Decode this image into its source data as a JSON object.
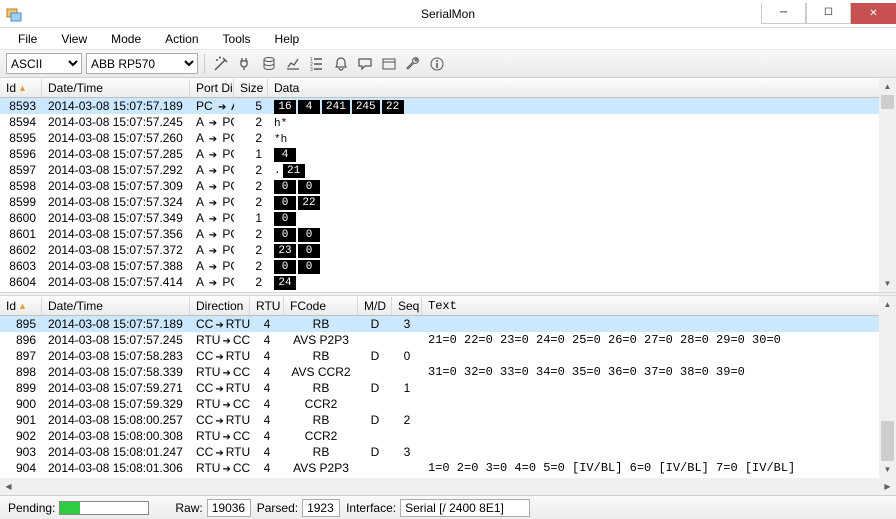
{
  "window": {
    "title": "SerialMon"
  },
  "menu": {
    "items": [
      "File",
      "View",
      "Mode",
      "Action",
      "Tools",
      "Help"
    ]
  },
  "toolbar": {
    "encoding_options": [
      "ASCII"
    ],
    "encoding_value": "ASCII",
    "protocol_options": [
      "ABB RP570"
    ],
    "protocol_value": "ABB RP570",
    "icons": [
      "wand",
      "plug",
      "database",
      "chart",
      "list",
      "bell",
      "comment",
      "window",
      "wrench",
      "info"
    ]
  },
  "grid1": {
    "headers": {
      "id": "Id",
      "datetime": "Date/Time",
      "portdir": "Port Dir",
      "size": "Size",
      "data": "Data"
    },
    "rows": [
      {
        "id": 8593,
        "dt": "2014-03-08 15:07:57.189",
        "pdA": "PC",
        "pdB": "A",
        "size": 5,
        "data": [
          {
            "t": "b",
            "v": "16"
          },
          {
            "t": "b",
            "v": "4"
          },
          {
            "t": "b",
            "v": "241"
          },
          {
            "t": "b",
            "v": "245"
          },
          {
            "t": "b",
            "v": "22"
          }
        ],
        "sel": true
      },
      {
        "id": 8594,
        "dt": "2014-03-08 15:07:57.245",
        "pdA": "A",
        "pdB": "PC",
        "size": 2,
        "data": [
          {
            "t": "p",
            "v": "h*"
          }
        ]
      },
      {
        "id": 8595,
        "dt": "2014-03-08 15:07:57.260",
        "pdA": "A",
        "pdB": "PC",
        "size": 2,
        "data": [
          {
            "t": "p",
            "v": "*h"
          }
        ]
      },
      {
        "id": 8596,
        "dt": "2014-03-08 15:07:57.285",
        "pdA": "A",
        "pdB": "PC",
        "size": 1,
        "data": [
          {
            "t": "b",
            "v": "4"
          }
        ]
      },
      {
        "id": 8597,
        "dt": "2014-03-08 15:07:57.292",
        "pdA": "A",
        "pdB": "PC",
        "size": 2,
        "data": [
          {
            "t": "p",
            "v": "."
          },
          {
            "t": "b",
            "v": "21"
          }
        ]
      },
      {
        "id": 8598,
        "dt": "2014-03-08 15:07:57.309",
        "pdA": "A",
        "pdB": "PC",
        "size": 2,
        "data": [
          {
            "t": "b",
            "v": "0"
          },
          {
            "t": "b",
            "v": "0"
          }
        ]
      },
      {
        "id": 8599,
        "dt": "2014-03-08 15:07:57.324",
        "pdA": "A",
        "pdB": "PC",
        "size": 2,
        "data": [
          {
            "t": "b",
            "v": "0"
          },
          {
            "t": "b",
            "v": "22"
          }
        ]
      },
      {
        "id": 8600,
        "dt": "2014-03-08 15:07:57.349",
        "pdA": "A",
        "pdB": "PC",
        "size": 1,
        "data": [
          {
            "t": "b",
            "v": "0"
          }
        ]
      },
      {
        "id": 8601,
        "dt": "2014-03-08 15:07:57.356",
        "pdA": "A",
        "pdB": "PC",
        "size": 2,
        "data": [
          {
            "t": "b",
            "v": "0"
          },
          {
            "t": "b",
            "v": "0"
          }
        ]
      },
      {
        "id": 8602,
        "dt": "2014-03-08 15:07:57.372",
        "pdA": "A",
        "pdB": "PC",
        "size": 2,
        "data": [
          {
            "t": "b",
            "v": "23"
          },
          {
            "t": "b",
            "v": "0"
          }
        ]
      },
      {
        "id": 8603,
        "dt": "2014-03-08 15:07:57.388",
        "pdA": "A",
        "pdB": "PC",
        "size": 2,
        "data": [
          {
            "t": "b",
            "v": "0"
          },
          {
            "t": "b",
            "v": "0"
          }
        ]
      },
      {
        "id": 8604,
        "dt": "2014-03-08 15:07:57.414",
        "pdA": "A",
        "pdB": "PC",
        "size": 2,
        "data": [
          {
            "t": "b",
            "v": "24"
          }
        ]
      }
    ]
  },
  "grid2": {
    "headers": {
      "id": "Id",
      "datetime": "Date/Time",
      "direction": "Direction",
      "rtu": "RTU",
      "fcode": "FCode",
      "md": "M/D",
      "seq": "Seq",
      "text": "Text"
    },
    "rows": [
      {
        "id": 895,
        "dt": "2014-03-08 15:07:57.189",
        "dirA": "CC",
        "dirB": "RTU",
        "rtu": 4,
        "fc": "RB",
        "md": "D",
        "seq": 3,
        "txt": "",
        "sel": true
      },
      {
        "id": 896,
        "dt": "2014-03-08 15:07:57.245",
        "dirA": "RTU",
        "dirB": "CC",
        "rtu": 4,
        "fc": "AVS P2P3",
        "md": "",
        "seq": "",
        "txt": "21=0 22=0 23=0 24=0 25=0 26=0 27=0 28=0 29=0 30=0"
      },
      {
        "id": 897,
        "dt": "2014-03-08 15:07:58.283",
        "dirA": "CC",
        "dirB": "RTU",
        "rtu": 4,
        "fc": "RB",
        "md": "D",
        "seq": 0,
        "txt": ""
      },
      {
        "id": 898,
        "dt": "2014-03-08 15:07:58.339",
        "dirA": "RTU",
        "dirB": "CC",
        "rtu": 4,
        "fc": "AVS CCR2",
        "md": "",
        "seq": "",
        "txt": "31=0 32=0 33=0 34=0 35=0 36=0 37=0 38=0 39=0"
      },
      {
        "id": 899,
        "dt": "2014-03-08 15:07:59.271",
        "dirA": "CC",
        "dirB": "RTU",
        "rtu": 4,
        "fc": "RB",
        "md": "D",
        "seq": 1,
        "txt": ""
      },
      {
        "id": 900,
        "dt": "2014-03-08 15:07:59.329",
        "dirA": "RTU",
        "dirB": "CC",
        "rtu": 4,
        "fc": "CCR2",
        "md": "",
        "seq": "",
        "txt": ""
      },
      {
        "id": 901,
        "dt": "2014-03-08 15:08:00.257",
        "dirA": "CC",
        "dirB": "RTU",
        "rtu": 4,
        "fc": "RB",
        "md": "D",
        "seq": 2,
        "txt": ""
      },
      {
        "id": 902,
        "dt": "2014-03-08 15:08:00.308",
        "dirA": "RTU",
        "dirB": "CC",
        "rtu": 4,
        "fc": "CCR2",
        "md": "",
        "seq": "",
        "txt": ""
      },
      {
        "id": 903,
        "dt": "2014-03-08 15:08:01.247",
        "dirA": "CC",
        "dirB": "RTU",
        "rtu": 4,
        "fc": "RB",
        "md": "D",
        "seq": 3,
        "txt": ""
      },
      {
        "id": 904,
        "dt": "2014-03-08 15:08:01.306",
        "dirA": "RTU",
        "dirB": "CC",
        "rtu": 4,
        "fc": "AVS P2P3",
        "md": "",
        "seq": "",
        "txt": "1=0 2=0 3=0 4=0 5=0 [IV/BL] 6=0 [IV/BL] 7=0 [IV/BL]"
      }
    ]
  },
  "status": {
    "pending_label": "Pending:",
    "pending_pct": 22,
    "raw_label": "Raw:",
    "raw_value": "19036",
    "parsed_label": "Parsed:",
    "parsed_value": "1923",
    "interface_label": "Interface:",
    "interface_value": "Serial [/ 2400 8E1]"
  }
}
